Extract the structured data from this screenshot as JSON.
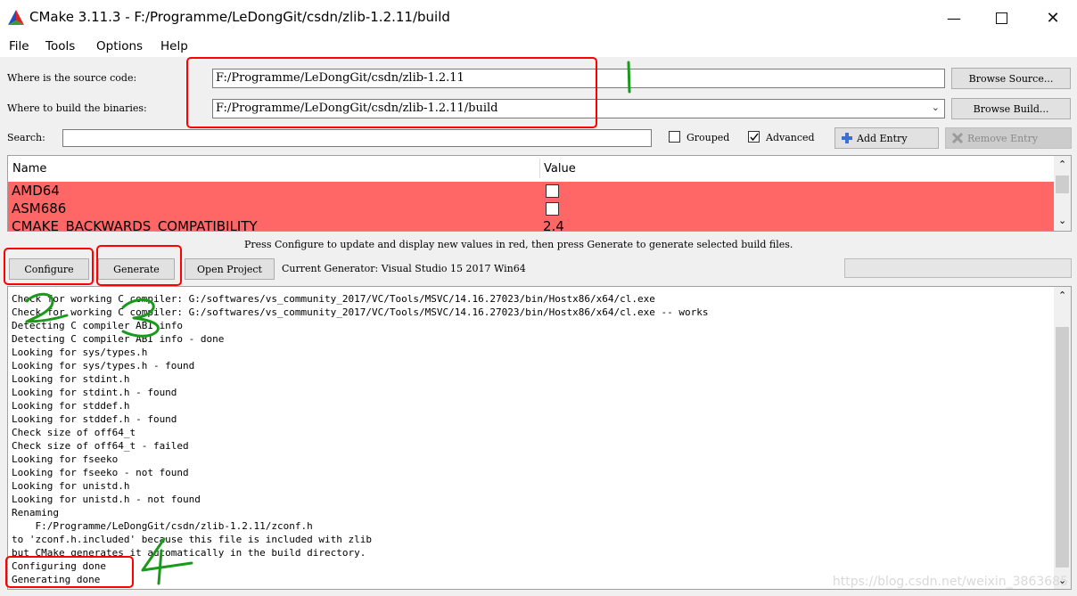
{
  "window": {
    "title": "CMake 3.11.3 - F:/Programme/LeDongGit/csdn/zlib-1.2.11/build"
  },
  "menu": [
    "File",
    "Tools",
    "Options",
    "Help"
  ],
  "source": {
    "label": "Where is the source code:",
    "value": "F:/Programme/LeDongGit/csdn/zlib-1.2.11",
    "browse_label": "Browse Source..."
  },
  "build": {
    "label": "Where to build the binaries:",
    "value": "F:/Programme/LeDongGit/csdn/zlib-1.2.11/build",
    "browse_label": "Browse Build..."
  },
  "search": {
    "label": "Search:",
    "value": ""
  },
  "options": {
    "grouped_label": "Grouped",
    "grouped_checked": false,
    "advanced_label": "Advanced",
    "advanced_checked": true
  },
  "entry_buttons": {
    "add": "Add Entry",
    "remove": "Remove Entry"
  },
  "table": {
    "headers": [
      "Name",
      "Value"
    ],
    "rows": [
      {
        "name": "AMD64",
        "value": "",
        "checkbox": true
      },
      {
        "name": "ASM686",
        "value": "",
        "checkbox": true
      },
      {
        "name": "CMAKE_BACKWARDS_COMPATIBILITY",
        "value": "2.4",
        "checkbox": false
      }
    ],
    "highlight_color": "#ff6666"
  },
  "hint": "Press Configure to update and display new values in red, then press Generate to generate selected build files.",
  "actions": {
    "configure": "Configure",
    "generate": "Generate",
    "open_project": "Open Project"
  },
  "generator": "Current Generator: Visual Studio 15 2017 Win64",
  "log": [
    "Check for working C compiler: G:/softwares/vs_community_2017/VC/Tools/MSVC/14.16.27023/bin/Hostx86/x64/cl.exe",
    "Check for working C compiler: G:/softwares/vs_community_2017/VC/Tools/MSVC/14.16.27023/bin/Hostx86/x64/cl.exe -- works",
    "Detecting C compiler ABI info",
    "Detecting C compiler ABI info - done",
    "Looking for sys/types.h",
    "Looking for sys/types.h - found",
    "Looking for stdint.h",
    "Looking for stdint.h - found",
    "Looking for stddef.h",
    "Looking for stddef.h - found",
    "Check size of off64_t",
    "Check size of off64_t - failed",
    "Looking for fseeko",
    "Looking for fseeko - not found",
    "Looking for unistd.h",
    "Looking for unistd.h - not found",
    "Renaming",
    "    F:/Programme/LeDongGit/csdn/zlib-1.2.11/zconf.h",
    "to 'zconf.h.included' because this file is included with zlib",
    "but CMake generates it automatically in the build directory.",
    "Configuring done",
    "Generating done"
  ],
  "watermark": "https://blog.csdn.net/weixin_3863685",
  "annotation_color": "#ff0000",
  "handwriting_color": "#1a9a1a"
}
